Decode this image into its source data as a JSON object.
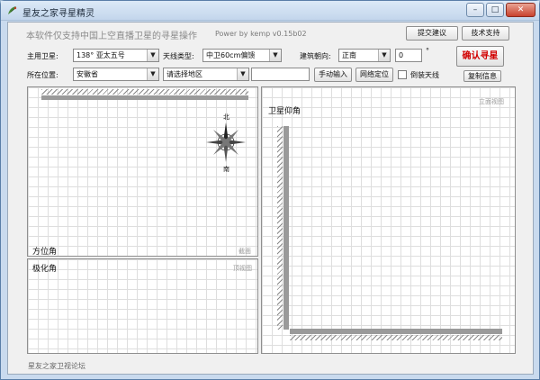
{
  "window": {
    "title": "星友之家寻星精灵",
    "controls": {
      "minimize": "–",
      "maximize": "□",
      "close": "✕"
    }
  },
  "header": {
    "notice": "本软件仅支持中国上空直播卫星的寻星操作",
    "power": "Power by kemp  v0.15b02",
    "feedback_label": "提交建议",
    "support_label": "技术支持"
  },
  "form": {
    "satellite_label": "主用卫星:",
    "satellite_value": "138°    亚太五号",
    "antenna_label": "天线类型:",
    "antenna_value": "中卫60cm偏馈",
    "orientation_label": "建筑朝向:",
    "orientation_value": "正南",
    "angle_value": "0",
    "degree_symbol": "°",
    "location_label": "所在位置:",
    "province_value": "安徽省",
    "region_value": "请选择地区",
    "city_value": "",
    "manual_input_label": "手动输入",
    "online_locate_label": "网络定位",
    "inverted_antenna_label": "倒装天线",
    "inverted_antenna_checked": false,
    "confirm_label": "确认寻星",
    "copy_info_label": "复制信息"
  },
  "panels": {
    "azimuth": {
      "title": "方位角",
      "hint": "截面",
      "compass_north": "北",
      "compass_south": "南"
    },
    "polarization": {
      "title": "极化角",
      "hint": "顶视图"
    },
    "elevation": {
      "title": "卫星仰角",
      "hint": "立面视图"
    }
  },
  "footer": {
    "text": "星友之家卫视论坛"
  },
  "icons": {
    "app": "satellite-dish-icon",
    "compass": "compass-rose-icon",
    "dropdown": "chevron-down-icon"
  }
}
